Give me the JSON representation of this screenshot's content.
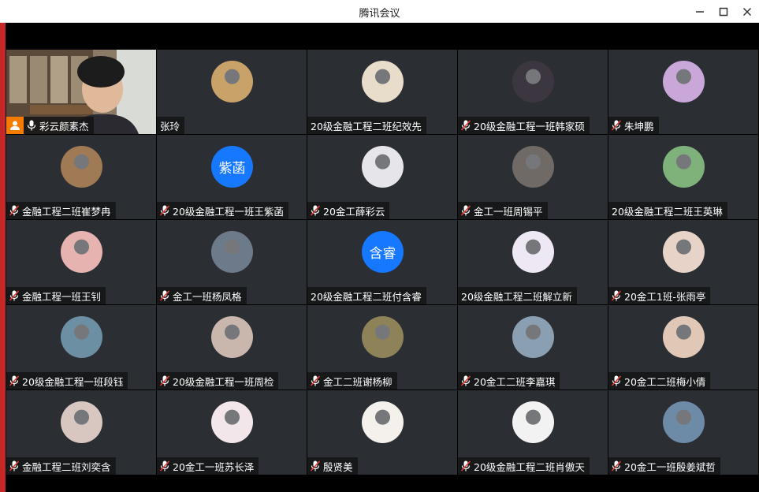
{
  "window": {
    "title": "腾讯会议",
    "controls": [
      "minimize-icon",
      "maximize-icon",
      "close-icon"
    ]
  },
  "participants": [
    {
      "name": "彩云颜素杰",
      "avatar": "video",
      "mic": "on",
      "host": true
    },
    {
      "name": "张玲",
      "avatar": "photo",
      "mic": "none",
      "color": "#c9a26a"
    },
    {
      "name": "20级金融工程二班纪效先",
      "avatar": "photo",
      "mic": "none",
      "color": "#e8dccb"
    },
    {
      "name": "20级金融工程一班韩家硕",
      "avatar": "photo",
      "mic": "muted",
      "color": "#3b3640"
    },
    {
      "name": "朱坤鹏",
      "avatar": "photo",
      "mic": "muted",
      "color": "#c9a8d9"
    },
    {
      "name": "金融工程二班崔梦冉",
      "avatar": "photo",
      "mic": "muted",
      "color": "#a07a55"
    },
    {
      "name": "20级金融工程一班王紫菡",
      "avatar": "text",
      "avatar_text": "紫菡",
      "mic": "muted"
    },
    {
      "name": "20金工薛彩云",
      "avatar": "photo",
      "mic": "muted",
      "color": "#e6e6ea"
    },
    {
      "name": "金工一班周锡平",
      "avatar": "photo",
      "mic": "muted",
      "color": "#6f6a66"
    },
    {
      "name": "20级金融工程二班王英琳",
      "avatar": "photo",
      "mic": "none",
      "color": "#7fb27a"
    },
    {
      "name": "金融工程一班王钊",
      "avatar": "photo",
      "mic": "muted",
      "color": "#e7b3b0"
    },
    {
      "name": "金工一班杨凤格",
      "avatar": "photo",
      "mic": "muted",
      "color": "#6d7a8a"
    },
    {
      "name": "20级金融工程二班付含睿",
      "avatar": "text",
      "avatar_text": "含睿",
      "mic": "none"
    },
    {
      "name": "20级金融工程二班解立新",
      "avatar": "photo",
      "mic": "none",
      "color": "#eee8f4"
    },
    {
      "name": "20金工1班-张雨亭",
      "avatar": "photo",
      "mic": "muted",
      "color": "#e8d3c8"
    },
    {
      "name": "20级金融工程一班段钰",
      "avatar": "photo",
      "mic": "muted",
      "color": "#6d8fa3"
    },
    {
      "name": "20级金融工程一班周检",
      "avatar": "photo",
      "mic": "muted",
      "color": "#c9b6ac"
    },
    {
      "name": "金工二班谢杨柳",
      "avatar": "photo",
      "mic": "muted",
      "color": "#8e8258"
    },
    {
      "name": "20金工二班李嘉琪",
      "avatar": "photo",
      "mic": "muted",
      "color": "#8aa0b2"
    },
    {
      "name": "20金工二班梅小倩",
      "avatar": "photo",
      "mic": "muted",
      "color": "#e0c7b6"
    },
    {
      "name": "金融工程二班刘奕含",
      "avatar": "photo",
      "mic": "muted",
      "color": "#d8c6c0"
    },
    {
      "name": "20金工一班苏长泽",
      "avatar": "photo",
      "mic": "muted",
      "color": "#f2e6ea"
    },
    {
      "name": "殷贤美",
      "avatar": "photo",
      "mic": "muted",
      "color": "#f4f0ec"
    },
    {
      "name": "20级金融工程二班肖傲天",
      "avatar": "photo",
      "mic": "muted",
      "color": "#f2f2f2"
    },
    {
      "name": "20金工一班殷姜斌哲",
      "avatar": "photo",
      "mic": "muted",
      "color": "#6d8aa6"
    }
  ]
}
